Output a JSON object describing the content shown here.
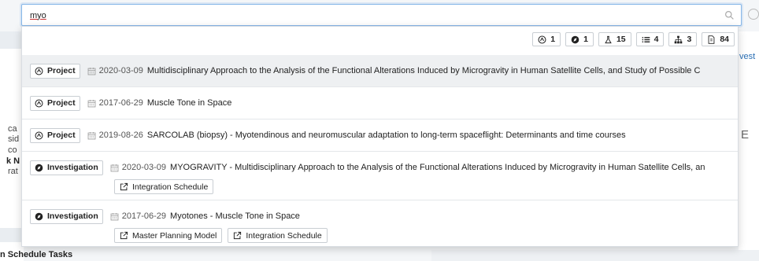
{
  "search": {
    "value": "myo"
  },
  "counts": [
    {
      "icon": "project-icon",
      "value": "1"
    },
    {
      "icon": "investigation-icon",
      "value": "1"
    },
    {
      "icon": "flask-icon",
      "value": "15"
    },
    {
      "icon": "list-icon",
      "value": "4"
    },
    {
      "icon": "hierarchy-icon",
      "value": "3"
    },
    {
      "icon": "document-icon",
      "value": "84"
    }
  ],
  "results": [
    {
      "type": "Project",
      "date": "2020-03-09",
      "title": "Multidisciplinary Approach to the Analysis of the Functional Alterations Induced by Microgravity in Human Satellite Cells, and Study of Possible C",
      "links": []
    },
    {
      "type": "Project",
      "date": "2017-06-29",
      "title": "Muscle Tone in Space",
      "links": []
    },
    {
      "type": "Project",
      "date": "2019-08-26",
      "title": "SARCOLAB (biopsy) - Myotendinous and neuromuscular adaptation to long-term spaceflight: Determinants and time courses",
      "links": []
    },
    {
      "type": "Investigation",
      "date": "2020-03-09",
      "title": "MYOGRAVITY - Multidisciplinary Approach to the Analysis of the Functional Alterations Induced by Microgravity in Human Satellite Cells, an",
      "links": [
        "Integration Schedule"
      ]
    },
    {
      "type": "Investigation",
      "date": "2017-06-29",
      "title": "Myotones - Muscle Tone in Space",
      "links": [
        "Master Planning Model",
        "Integration Schedule"
      ]
    }
  ],
  "background": {
    "frag1": "ca",
    "frag2": "sid",
    "frag3": "co",
    "frag4": "k N",
    "frag5": "rat",
    "right_frag": "vest",
    "right_e": "E",
    "bottom_text": "n Schedule Tasks"
  }
}
